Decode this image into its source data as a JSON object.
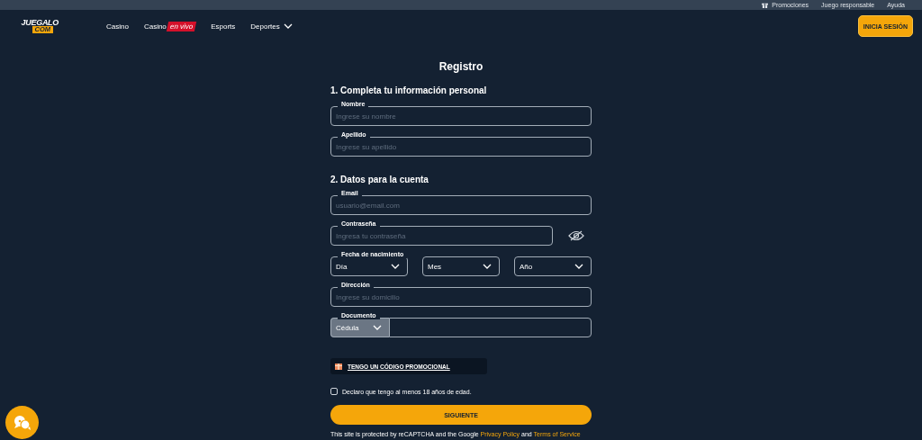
{
  "top_links": [
    {
      "label": "Promociones",
      "kind": "gift"
    },
    {
      "label": "Juego responsable",
      "kind": "plain"
    },
    {
      "label": "Ayuda",
      "kind": "plain"
    }
  ],
  "logo": {
    "top": "JUEGALO",
    "bottom": "COM"
  },
  "nav": [
    {
      "label": "Casino"
    },
    {
      "label": "Casino",
      "badge": "en vivo"
    },
    {
      "label": "Esports"
    },
    {
      "label": "Deportes",
      "dropdown": true
    }
  ],
  "login_button": "INICIA SESIÓN",
  "title": "Registro",
  "sections": [
    {
      "title": "1. Completa tu información personal",
      "fields": [
        {
          "kind": "text",
          "label": "Nombre",
          "placeholder": "Ingrese su nombre"
        },
        {
          "kind": "text",
          "label": "Apellido",
          "placeholder": "Ingrese su apellido"
        }
      ]
    },
    {
      "title": "2. Datos para la cuenta",
      "fields": [
        {
          "kind": "text",
          "label": "Email",
          "placeholder": "usuario@email.com"
        },
        {
          "kind": "password",
          "label": "Contraseña",
          "placeholder": "Ingresa tu contraseña"
        },
        {
          "kind": "date",
          "label": "Fecha de nacimiento",
          "selects": [
            "Día",
            "Mes",
            "Año"
          ]
        },
        {
          "kind": "text",
          "label": "Dirección",
          "placeholder": "Ingrese su domicilio"
        },
        {
          "kind": "document",
          "label": "Documento",
          "select": "Cédula"
        }
      ]
    }
  ],
  "promo_link": "TENGO UN CÓDIGO PROMOCIONAL",
  "age_checkbox": {
    "label": "Declaro que tengo al menos 18 años de edad.",
    "checked": false
  },
  "submit_button": "SIGUIENTE",
  "recaptcha": {
    "before": "This site is protected by reCAPTCHA and the Google",
    "privacy": "Privacy Policy",
    "and": "and",
    "terms": "Terms of Service"
  }
}
